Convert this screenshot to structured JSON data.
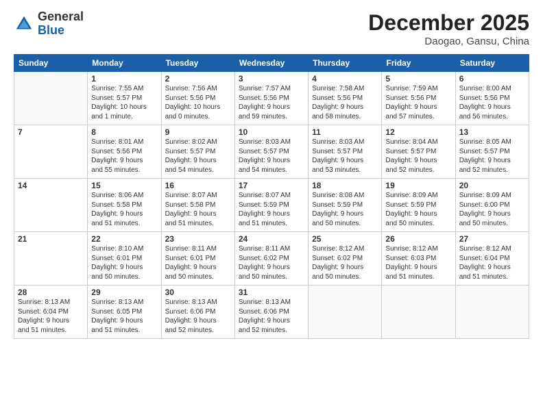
{
  "logo": {
    "general": "General",
    "blue": "Blue"
  },
  "title": "December 2025",
  "location": "Daogao, Gansu, China",
  "days_header": [
    "Sunday",
    "Monday",
    "Tuesday",
    "Wednesday",
    "Thursday",
    "Friday",
    "Saturday"
  ],
  "weeks": [
    [
      {
        "day": "",
        "info": ""
      },
      {
        "day": "1",
        "info": "Sunrise: 7:55 AM\nSunset: 5:57 PM\nDaylight: 10 hours\nand 1 minute."
      },
      {
        "day": "2",
        "info": "Sunrise: 7:56 AM\nSunset: 5:56 PM\nDaylight: 10 hours\nand 0 minutes."
      },
      {
        "day": "3",
        "info": "Sunrise: 7:57 AM\nSunset: 5:56 PM\nDaylight: 9 hours\nand 59 minutes."
      },
      {
        "day": "4",
        "info": "Sunrise: 7:58 AM\nSunset: 5:56 PM\nDaylight: 9 hours\nand 58 minutes."
      },
      {
        "day": "5",
        "info": "Sunrise: 7:59 AM\nSunset: 5:56 PM\nDaylight: 9 hours\nand 57 minutes."
      },
      {
        "day": "6",
        "info": "Sunrise: 8:00 AM\nSunset: 5:56 PM\nDaylight: 9 hours\nand 56 minutes."
      }
    ],
    [
      {
        "day": "7",
        "info": ""
      },
      {
        "day": "8",
        "info": "Sunrise: 8:01 AM\nSunset: 5:56 PM\nDaylight: 9 hours\nand 55 minutes."
      },
      {
        "day": "9",
        "info": "Sunrise: 8:02 AM\nSunset: 5:57 PM\nDaylight: 9 hours\nand 54 minutes."
      },
      {
        "day": "10",
        "info": "Sunrise: 8:03 AM\nSunset: 5:57 PM\nDaylight: 9 hours\nand 54 minutes."
      },
      {
        "day": "11",
        "info": "Sunrise: 8:03 AM\nSunset: 5:57 PM\nDaylight: 9 hours\nand 53 minutes."
      },
      {
        "day": "12",
        "info": "Sunrise: 8:04 AM\nSunset: 5:57 PM\nDaylight: 9 hours\nand 52 minutes."
      },
      {
        "day": "13",
        "info": "Sunrise: 8:05 AM\nSunset: 5:57 PM\nDaylight: 9 hours\nand 52 minutes."
      }
    ],
    [
      {
        "day": "14",
        "info": ""
      },
      {
        "day": "15",
        "info": "Sunrise: 8:06 AM\nSunset: 5:58 PM\nDaylight: 9 hours\nand 51 minutes."
      },
      {
        "day": "16",
        "info": "Sunrise: 8:07 AM\nSunset: 5:58 PM\nDaylight: 9 hours\nand 51 minutes."
      },
      {
        "day": "17",
        "info": "Sunrise: 8:07 AM\nSunset: 5:59 PM\nDaylight: 9 hours\nand 51 minutes."
      },
      {
        "day": "18",
        "info": "Sunrise: 8:08 AM\nSunset: 5:59 PM\nDaylight: 9 hours\nand 50 minutes."
      },
      {
        "day": "19",
        "info": "Sunrise: 8:09 AM\nSunset: 5:59 PM\nDaylight: 9 hours\nand 50 minutes."
      },
      {
        "day": "20",
        "info": "Sunrise: 8:09 AM\nSunset: 6:00 PM\nDaylight: 9 hours\nand 50 minutes."
      }
    ],
    [
      {
        "day": "21",
        "info": ""
      },
      {
        "day": "22",
        "info": "Sunrise: 8:10 AM\nSunset: 6:01 PM\nDaylight: 9 hours\nand 50 minutes."
      },
      {
        "day": "23",
        "info": "Sunrise: 8:11 AM\nSunset: 6:01 PM\nDaylight: 9 hours\nand 50 minutes."
      },
      {
        "day": "24",
        "info": "Sunrise: 8:11 AM\nSunset: 6:02 PM\nDaylight: 9 hours\nand 50 minutes."
      },
      {
        "day": "25",
        "info": "Sunrise: 8:12 AM\nSunset: 6:02 PM\nDaylight: 9 hours\nand 50 minutes."
      },
      {
        "day": "26",
        "info": "Sunrise: 8:12 AM\nSunset: 6:03 PM\nDaylight: 9 hours\nand 51 minutes."
      },
      {
        "day": "27",
        "info": "Sunrise: 8:12 AM\nSunset: 6:04 PM\nDaylight: 9 hours\nand 51 minutes."
      }
    ],
    [
      {
        "day": "28",
        "info": "Sunrise: 8:13 AM\nSunset: 6:04 PM\nDaylight: 9 hours\nand 51 minutes."
      },
      {
        "day": "29",
        "info": "Sunrise: 8:13 AM\nSunset: 6:05 PM\nDaylight: 9 hours\nand 51 minutes."
      },
      {
        "day": "30",
        "info": "Sunrise: 8:13 AM\nSunset: 6:06 PM\nDaylight: 9 hours\nand 52 minutes."
      },
      {
        "day": "31",
        "info": "Sunrise: 8:13 AM\nSunset: 6:06 PM\nDaylight: 9 hours\nand 52 minutes."
      },
      {
        "day": "",
        "info": ""
      },
      {
        "day": "",
        "info": ""
      },
      {
        "day": "",
        "info": ""
      }
    ]
  ]
}
